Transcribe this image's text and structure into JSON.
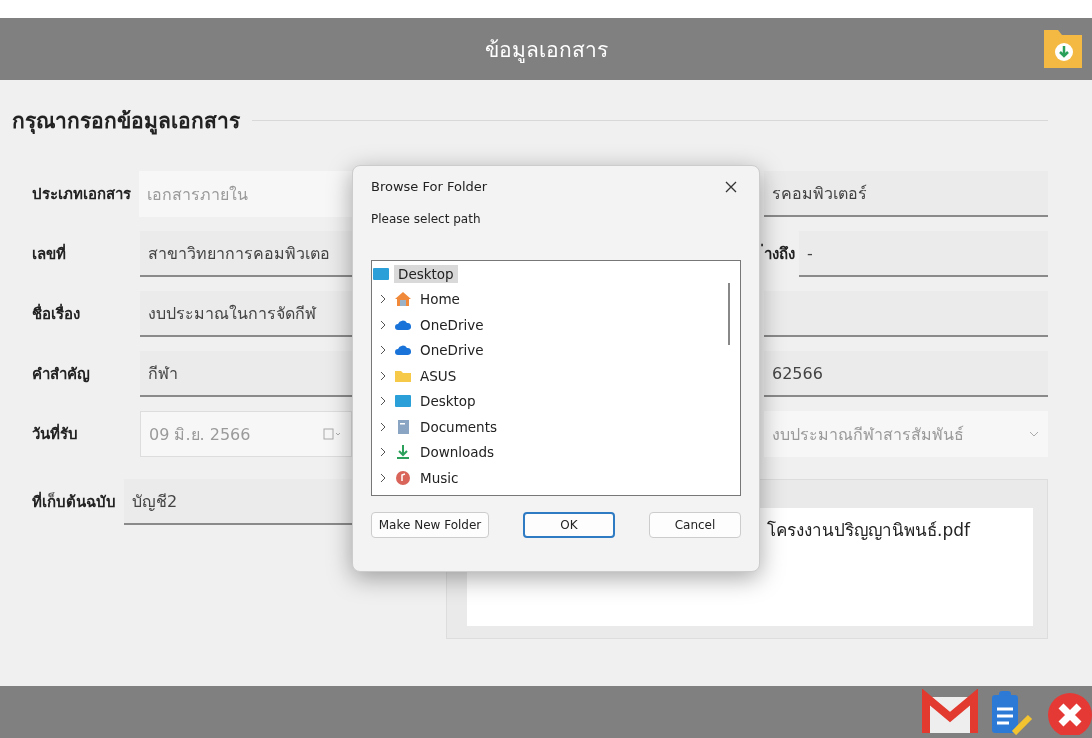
{
  "window": {
    "title": "ข้อมูลเอกสาร"
  },
  "form": {
    "heading": "กรุณากรอกข้อมูลเอกสาร",
    "left_rows": [
      {
        "label": "ประเภทเอกสาร",
        "value": "เอกสารภายใน",
        "kind": "text",
        "disabled": true
      },
      {
        "label": "เลขที่",
        "value": "สาขาวิทยาการคอมพิวเตอ",
        "kind": "field",
        "disabled": false
      },
      {
        "label": "ชื่อเรื่อง",
        "value": "งบประมาณในการจัดกีฬ",
        "kind": "field",
        "disabled": false
      },
      {
        "label": "คำสำคัญ",
        "value": "กีฬา",
        "kind": "field",
        "disabled": false
      },
      {
        "label": "วันที่รับ",
        "value": "09 มิ.ย.   2566",
        "kind": "date",
        "disabled": true
      },
      {
        "label": "ที่เก็บต้นฉบับ",
        "value": "บัญชี2",
        "kind": "field",
        "disabled": false
      }
    ],
    "right_rows": [
      {
        "value": "รคอมพิวเตอร์",
        "kind": "field",
        "disabled": false
      },
      {
        "label": "่างถึง",
        "value": "-",
        "kind": "field",
        "disabled": false
      },
      {
        "kind": "field",
        "disabled": false
      },
      {
        "value": "62566",
        "kind": "field",
        "disabled": false
      },
      {
        "value": "งบประมาณกีฬาสารสัมพันธ์",
        "kind": "dropdown",
        "disabled": true
      }
    ],
    "attachment": {
      "file_name": "โครงงานปริญญานิพนธ์.pdf"
    }
  },
  "dialog": {
    "title": "Browse For Folder",
    "prompt": "Please select path",
    "tree": [
      {
        "label": "Desktop",
        "kind": "desktop",
        "selected": true,
        "children": [
          {
            "label": "Home",
            "kind": "home",
            "selected": false,
            "expanded": false
          },
          {
            "label": "OneDrive",
            "kind": "cloud",
            "selected": false,
            "expanded": false
          },
          {
            "label": "OneDrive",
            "kind": "cloud",
            "selected": false,
            "expanded": false
          },
          {
            "label": "ASUS",
            "kind": "folder",
            "selected": false,
            "expanded": false
          },
          {
            "label": "Desktop",
            "kind": "desktop",
            "selected": false,
            "expanded": false
          },
          {
            "label": "Documents",
            "kind": "documents",
            "selected": false,
            "expanded": false
          },
          {
            "label": "Downloads",
            "kind": "downloads",
            "selected": false,
            "expanded": false
          },
          {
            "label": "Music",
            "kind": "music",
            "selected": false,
            "expanded": false
          }
        ]
      }
    ],
    "buttons": [
      {
        "label": "Make New Folder",
        "default": false
      },
      {
        "label": "OK",
        "default": true
      },
      {
        "label": "Cancel",
        "default": false
      }
    ]
  }
}
